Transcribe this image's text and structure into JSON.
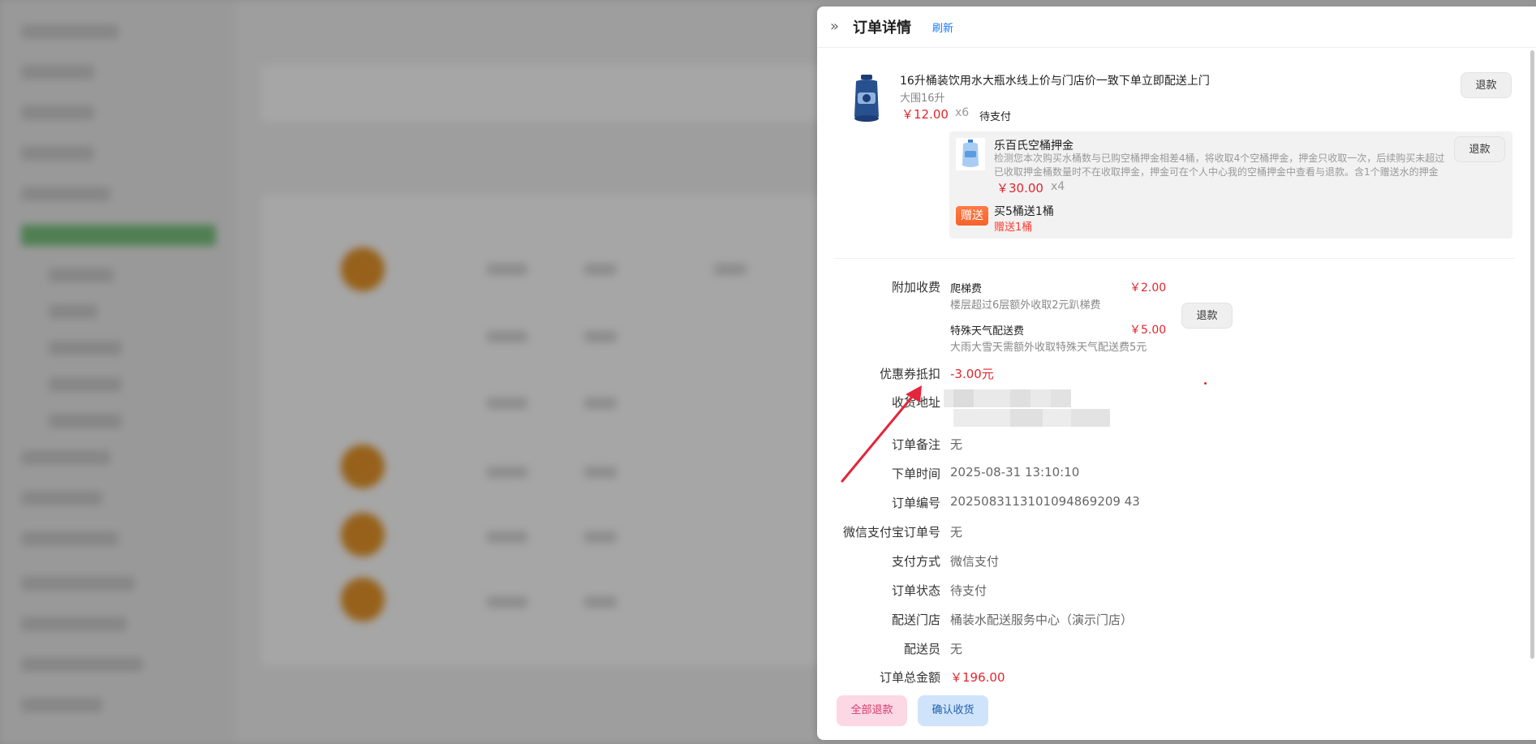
{
  "drawer": {
    "title": "订单详情",
    "refresh_label": "刷新"
  },
  "product": {
    "name": "16升桶装饮用水大瓶水线上价与门店价一致下单立即配送上门",
    "spec": "大围16升",
    "price": "￥12.00",
    "qty": "x6",
    "status": "待支付",
    "refund_label": "退款"
  },
  "deposit": {
    "title": "乐百氏空桶押金",
    "description": "检测您本次购买水桶数与已购空桶押金相差4桶，将收取4个空桶押金，押金只收取一次，后续购买未超过已收取押金桶数量时不在收取押金，押金可在个人中心我的空桶押金中查看与退款。含1个赠送水的押金",
    "price": "￥30.00",
    "qty": "x4",
    "refund_label": "退款",
    "gift_badge": "赠送",
    "gift_title": "买5桶送1桶",
    "gift_sub": "赠送1桶"
  },
  "fees": {
    "label": "附加收费",
    "items": [
      {
        "name": "爬梯费",
        "desc": "楼层超过6层额外收取2元趴梯费",
        "price": "￥2.00"
      },
      {
        "name": "特殊天气配送费",
        "desc": "大雨大雪天需额外收取特殊天气配送费5元",
        "price": "￥5.00"
      }
    ],
    "refund_label": "退款"
  },
  "info": {
    "coupon_label": "优惠券抵扣",
    "coupon_value": "-3.00元",
    "address_label": "收货地址",
    "remark_label": "订单备注",
    "remark_value": "无",
    "time_label": "下单时间",
    "time_value": "2025-08-31 13:10:10",
    "order_no_label": "订单编号",
    "order_no_value": "2025083113101094869209 43",
    "wechat_no_label": "微信支付宝订单号",
    "wechat_no_value": "无",
    "pay_method_label": "支付方式",
    "pay_method_value": "微信支付",
    "status_label": "订单状态",
    "status_value": "待支付",
    "store_label": "配送门店",
    "store_value": "桶装水配送服务中心（演示门店）",
    "courier_label": "配送员",
    "courier_value": "无",
    "total_label": "订单总金额",
    "total_value": "￥196.00"
  },
  "actions": {
    "refund_all": "全部退款",
    "confirm_receipt": "确认收货"
  }
}
